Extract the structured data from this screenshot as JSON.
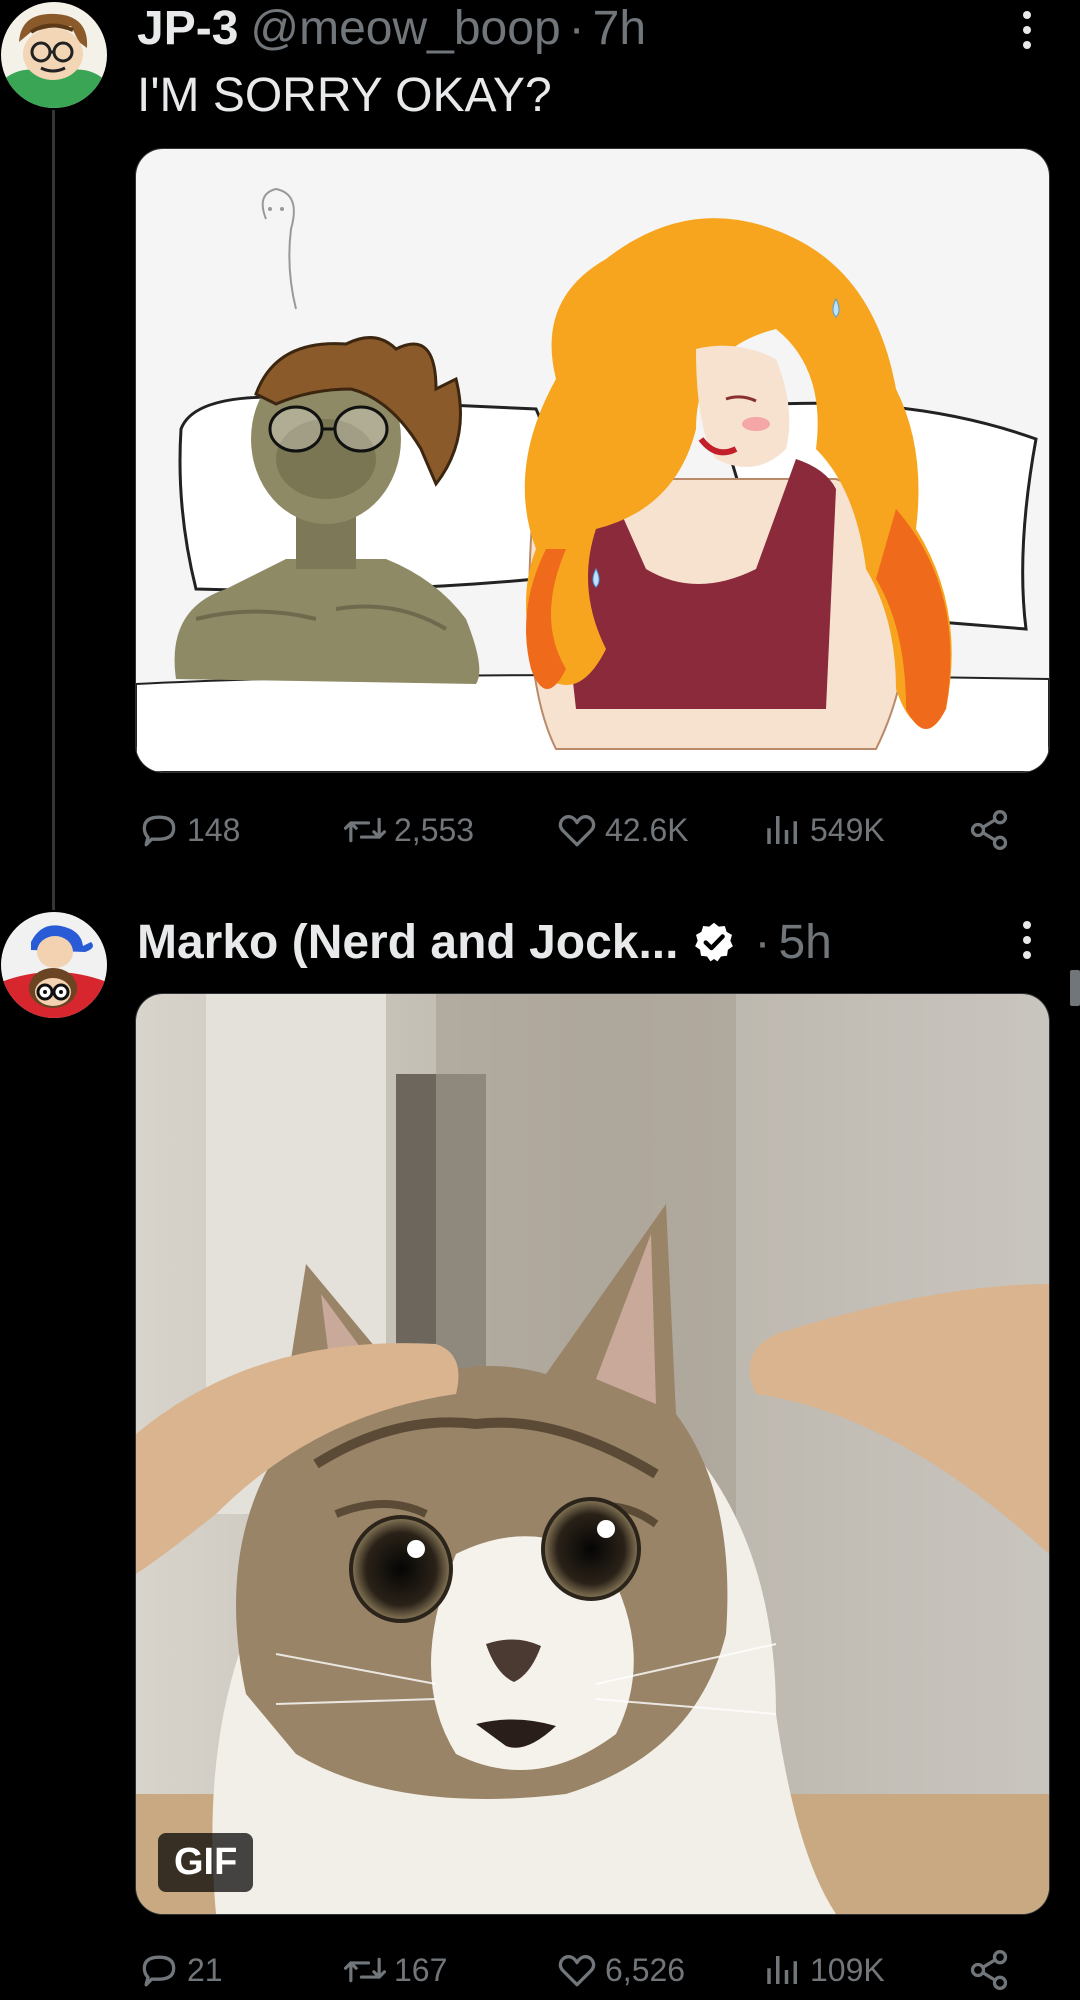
{
  "tweets": [
    {
      "display_name": "JP-3",
      "handle": "@meow_boop",
      "separator": "·",
      "time": "7h",
      "text": "I'M SORRY OKAY?",
      "verified": false,
      "media": {
        "type": "image",
        "alt": "cartoon illustration of an alien figure and a long-haired woman in bed"
      },
      "stats": {
        "replies": "148",
        "reposts": "2,553",
        "likes": "42.6K",
        "views": "549K"
      }
    },
    {
      "display_name": "Marko (Nerd and Jock...",
      "separator": "·",
      "time": "5h",
      "verified": true,
      "media": {
        "type": "gif",
        "badge": "GIF",
        "alt": "wide-eyed tabby cat being petted"
      },
      "stats": {
        "replies": "21",
        "reposts": "167",
        "likes": "6,526",
        "views": "109K"
      }
    }
  ],
  "icons": {
    "reply": "speech-bubble-icon",
    "repost": "repost-arrows-icon",
    "like": "heart-icon",
    "views": "bar-chart-icon",
    "share": "share-nodes-icon",
    "more": "vertical-ellipsis-icon",
    "verified": "verified-badge-icon"
  },
  "colors": {
    "background": "#000000",
    "primary_text": "#e7e9ea",
    "secondary_text": "#71767b",
    "thread_line": "#333639"
  }
}
